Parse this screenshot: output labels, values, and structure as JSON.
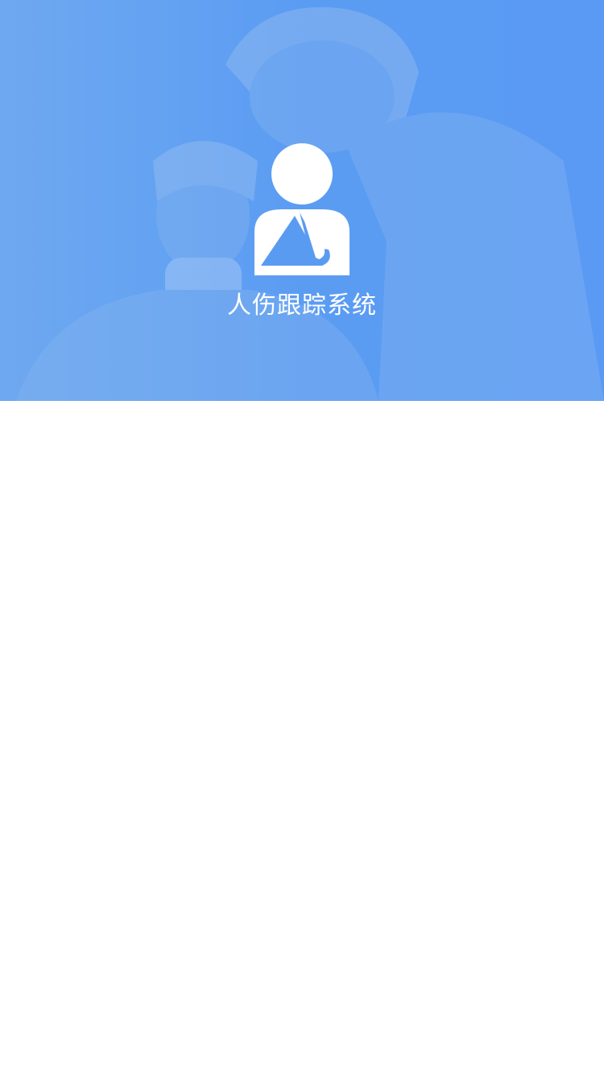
{
  "app": {
    "title": "人伤跟踪系统",
    "logo_icon": "injured-person-arm-sling-icon"
  },
  "colors": {
    "hero_blue": "#5a9bf2",
    "text_white": "#ffffff",
    "background": "#ffffff"
  }
}
